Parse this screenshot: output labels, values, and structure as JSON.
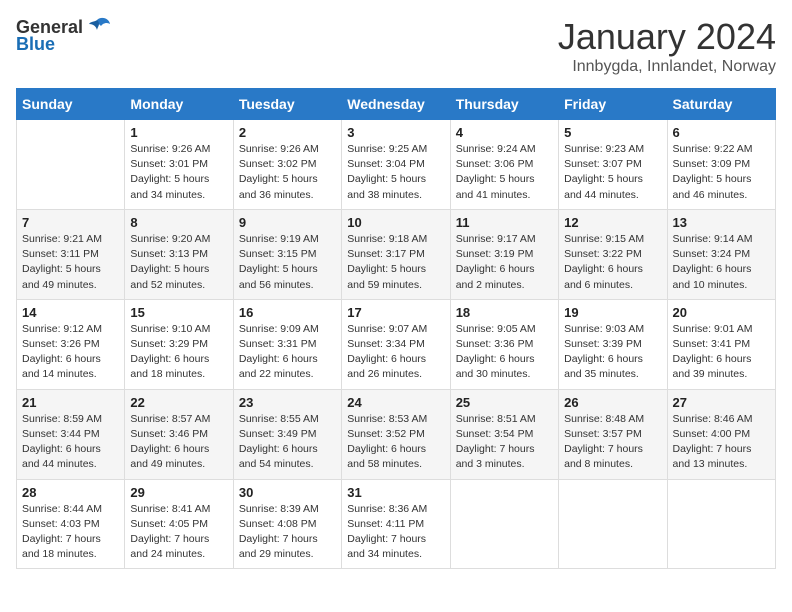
{
  "header": {
    "logo_general": "General",
    "logo_blue": "Blue",
    "title": "January 2024",
    "location": "Innbygda, Innlandet, Norway"
  },
  "weekdays": [
    "Sunday",
    "Monday",
    "Tuesday",
    "Wednesday",
    "Thursday",
    "Friday",
    "Saturday"
  ],
  "weeks": [
    [
      {
        "day": "",
        "sunrise": "",
        "sunset": "",
        "daylight": ""
      },
      {
        "day": "1",
        "sunrise": "Sunrise: 9:26 AM",
        "sunset": "Sunset: 3:01 PM",
        "daylight": "Daylight: 5 hours and 34 minutes."
      },
      {
        "day": "2",
        "sunrise": "Sunrise: 9:26 AM",
        "sunset": "Sunset: 3:02 PM",
        "daylight": "Daylight: 5 hours and 36 minutes."
      },
      {
        "day": "3",
        "sunrise": "Sunrise: 9:25 AM",
        "sunset": "Sunset: 3:04 PM",
        "daylight": "Daylight: 5 hours and 38 minutes."
      },
      {
        "day": "4",
        "sunrise": "Sunrise: 9:24 AM",
        "sunset": "Sunset: 3:06 PM",
        "daylight": "Daylight: 5 hours and 41 minutes."
      },
      {
        "day": "5",
        "sunrise": "Sunrise: 9:23 AM",
        "sunset": "Sunset: 3:07 PM",
        "daylight": "Daylight: 5 hours and 44 minutes."
      },
      {
        "day": "6",
        "sunrise": "Sunrise: 9:22 AM",
        "sunset": "Sunset: 3:09 PM",
        "daylight": "Daylight: 5 hours and 46 minutes."
      }
    ],
    [
      {
        "day": "7",
        "sunrise": "Sunrise: 9:21 AM",
        "sunset": "Sunset: 3:11 PM",
        "daylight": "Daylight: 5 hours and 49 minutes."
      },
      {
        "day": "8",
        "sunrise": "Sunrise: 9:20 AM",
        "sunset": "Sunset: 3:13 PM",
        "daylight": "Daylight: 5 hours and 52 minutes."
      },
      {
        "day": "9",
        "sunrise": "Sunrise: 9:19 AM",
        "sunset": "Sunset: 3:15 PM",
        "daylight": "Daylight: 5 hours and 56 minutes."
      },
      {
        "day": "10",
        "sunrise": "Sunrise: 9:18 AM",
        "sunset": "Sunset: 3:17 PM",
        "daylight": "Daylight: 5 hours and 59 minutes."
      },
      {
        "day": "11",
        "sunrise": "Sunrise: 9:17 AM",
        "sunset": "Sunset: 3:19 PM",
        "daylight": "Daylight: 6 hours and 2 minutes."
      },
      {
        "day": "12",
        "sunrise": "Sunrise: 9:15 AM",
        "sunset": "Sunset: 3:22 PM",
        "daylight": "Daylight: 6 hours and 6 minutes."
      },
      {
        "day": "13",
        "sunrise": "Sunrise: 9:14 AM",
        "sunset": "Sunset: 3:24 PM",
        "daylight": "Daylight: 6 hours and 10 minutes."
      }
    ],
    [
      {
        "day": "14",
        "sunrise": "Sunrise: 9:12 AM",
        "sunset": "Sunset: 3:26 PM",
        "daylight": "Daylight: 6 hours and 14 minutes."
      },
      {
        "day": "15",
        "sunrise": "Sunrise: 9:10 AM",
        "sunset": "Sunset: 3:29 PM",
        "daylight": "Daylight: 6 hours and 18 minutes."
      },
      {
        "day": "16",
        "sunrise": "Sunrise: 9:09 AM",
        "sunset": "Sunset: 3:31 PM",
        "daylight": "Daylight: 6 hours and 22 minutes."
      },
      {
        "day": "17",
        "sunrise": "Sunrise: 9:07 AM",
        "sunset": "Sunset: 3:34 PM",
        "daylight": "Daylight: 6 hours and 26 minutes."
      },
      {
        "day": "18",
        "sunrise": "Sunrise: 9:05 AM",
        "sunset": "Sunset: 3:36 PM",
        "daylight": "Daylight: 6 hours and 30 minutes."
      },
      {
        "day": "19",
        "sunrise": "Sunrise: 9:03 AM",
        "sunset": "Sunset: 3:39 PM",
        "daylight": "Daylight: 6 hours and 35 minutes."
      },
      {
        "day": "20",
        "sunrise": "Sunrise: 9:01 AM",
        "sunset": "Sunset: 3:41 PM",
        "daylight": "Daylight: 6 hours and 39 minutes."
      }
    ],
    [
      {
        "day": "21",
        "sunrise": "Sunrise: 8:59 AM",
        "sunset": "Sunset: 3:44 PM",
        "daylight": "Daylight: 6 hours and 44 minutes."
      },
      {
        "day": "22",
        "sunrise": "Sunrise: 8:57 AM",
        "sunset": "Sunset: 3:46 PM",
        "daylight": "Daylight: 6 hours and 49 minutes."
      },
      {
        "day": "23",
        "sunrise": "Sunrise: 8:55 AM",
        "sunset": "Sunset: 3:49 PM",
        "daylight": "Daylight: 6 hours and 54 minutes."
      },
      {
        "day": "24",
        "sunrise": "Sunrise: 8:53 AM",
        "sunset": "Sunset: 3:52 PM",
        "daylight": "Daylight: 6 hours and 58 minutes."
      },
      {
        "day": "25",
        "sunrise": "Sunrise: 8:51 AM",
        "sunset": "Sunset: 3:54 PM",
        "daylight": "Daylight: 7 hours and 3 minutes."
      },
      {
        "day": "26",
        "sunrise": "Sunrise: 8:48 AM",
        "sunset": "Sunset: 3:57 PM",
        "daylight": "Daylight: 7 hours and 8 minutes."
      },
      {
        "day": "27",
        "sunrise": "Sunrise: 8:46 AM",
        "sunset": "Sunset: 4:00 PM",
        "daylight": "Daylight: 7 hours and 13 minutes."
      }
    ],
    [
      {
        "day": "28",
        "sunrise": "Sunrise: 8:44 AM",
        "sunset": "Sunset: 4:03 PM",
        "daylight": "Daylight: 7 hours and 18 minutes."
      },
      {
        "day": "29",
        "sunrise": "Sunrise: 8:41 AM",
        "sunset": "Sunset: 4:05 PM",
        "daylight": "Daylight: 7 hours and 24 minutes."
      },
      {
        "day": "30",
        "sunrise": "Sunrise: 8:39 AM",
        "sunset": "Sunset: 4:08 PM",
        "daylight": "Daylight: 7 hours and 29 minutes."
      },
      {
        "day": "31",
        "sunrise": "Sunrise: 8:36 AM",
        "sunset": "Sunset: 4:11 PM",
        "daylight": "Daylight: 7 hours and 34 minutes."
      },
      {
        "day": "",
        "sunrise": "",
        "sunset": "",
        "daylight": ""
      },
      {
        "day": "",
        "sunrise": "",
        "sunset": "",
        "daylight": ""
      },
      {
        "day": "",
        "sunrise": "",
        "sunset": "",
        "daylight": ""
      }
    ]
  ]
}
